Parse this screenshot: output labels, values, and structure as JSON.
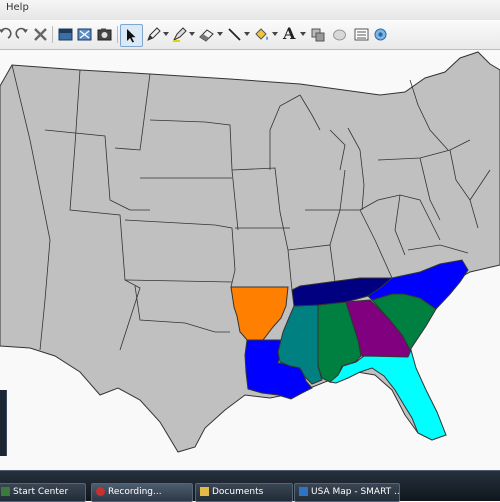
{
  "menubar": {
    "help_label": "Help"
  },
  "toolbar": {
    "tools": [
      {
        "name": "undo-icon"
      },
      {
        "name": "redo-icon"
      },
      {
        "name": "delete-icon"
      },
      {
        "name": "screen-shade-icon"
      },
      {
        "name": "fullscreen-icon"
      },
      {
        "name": "capture-icon"
      },
      {
        "name": "select-arrow-icon",
        "active": true
      },
      {
        "name": "pen-icon"
      },
      {
        "name": "highlighter-icon"
      },
      {
        "name": "eraser-icon"
      },
      {
        "name": "line-icon"
      },
      {
        "name": "fill-icon"
      },
      {
        "name": "text-tool-icon"
      },
      {
        "name": "shapes-icon"
      },
      {
        "name": "table-icon"
      },
      {
        "name": "properties-icon"
      },
      {
        "name": "recorder-icon"
      }
    ],
    "text_tool_glyph": "A"
  },
  "map": {
    "base_color": "#c0c0c0",
    "border_color": "#333333",
    "background": "#f9f9f9",
    "highlighted_states": [
      {
        "region": "arkansas",
        "color": "#ff8000"
      },
      {
        "region": "louisiana",
        "color": "#0000ff"
      },
      {
        "region": "mississippi",
        "color": "#008080"
      },
      {
        "region": "alabama",
        "color": "#008040"
      },
      {
        "region": "georgia",
        "color": "#800080"
      },
      {
        "region": "florida",
        "color": "#00ffff"
      },
      {
        "region": "south-carolina",
        "color": "#008040"
      },
      {
        "region": "north-carolina",
        "color": "#0000ff"
      },
      {
        "region": "tennessee",
        "color": "#000080"
      }
    ]
  },
  "taskbar": {
    "items": [
      {
        "label": "Start Center"
      },
      {
        "label": "Recording..."
      },
      {
        "label": "Documents"
      },
      {
        "label": "USA Map - SMART ..."
      }
    ]
  }
}
